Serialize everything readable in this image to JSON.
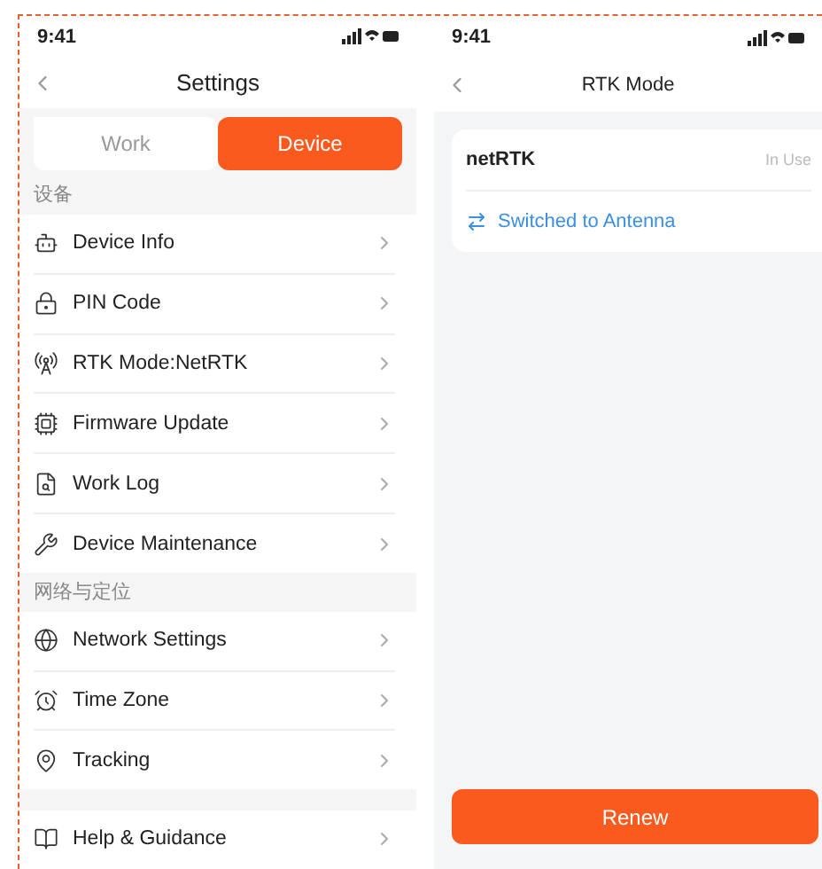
{
  "left_screen": {
    "status_bar": {
      "time": "9:41"
    },
    "title": "Settings",
    "tabs": [
      {
        "label": "Work",
        "selected": false
      },
      {
        "label": "Device",
        "selected": true
      }
    ],
    "sections": [
      {
        "heading": "设备",
        "items": [
          {
            "label": "Device Info"
          },
          {
            "label": "PIN Code"
          },
          {
            "label": "RTK Mode:NetRTK"
          },
          {
            "label": "Firmware Update"
          },
          {
            "label": "Work Log"
          },
          {
            "label": "Device Maintenance"
          }
        ]
      },
      {
        "heading": "网络与定位",
        "items": [
          {
            "label": "Network Settings"
          },
          {
            "label": "Time Zone"
          },
          {
            "label": "Tracking"
          }
        ]
      },
      {
        "items": [
          {
            "label": "Help & Guidance"
          }
        ]
      }
    ]
  },
  "right_screen": {
    "status_bar": {
      "time": "9:41"
    },
    "title": "RTK Mode",
    "mode": {
      "name": "netRTK",
      "status": "In Use"
    },
    "switch_link": "Switched to Antenna",
    "button": "Renew"
  }
}
